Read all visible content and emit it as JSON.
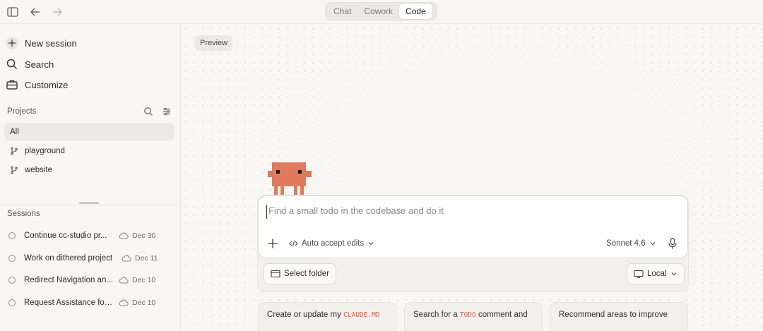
{
  "topbar": {
    "tabs": [
      {
        "label": "Chat",
        "active": false
      },
      {
        "label": "Cowork",
        "active": false
      },
      {
        "label": "Code",
        "active": true
      }
    ]
  },
  "sidebar": {
    "actions": [
      {
        "label": "New session",
        "icon": "plus-icon"
      },
      {
        "label": "Search",
        "icon": "search-icon"
      },
      {
        "label": "Customize",
        "icon": "briefcase-icon"
      }
    ],
    "projects_label": "Projects",
    "projects": [
      {
        "label": "All",
        "selected": true
      },
      {
        "label": "playground",
        "icon": "git-branch-icon"
      },
      {
        "label": "website",
        "icon": "git-branch-icon"
      }
    ],
    "sessions_label": "Sessions",
    "sessions": [
      {
        "title": "Continue cc-studio pr...",
        "date": "Dec 30"
      },
      {
        "title": "Work on dithered project",
        "date": "Dec 11"
      },
      {
        "title": "Redirect Navigation an...",
        "date": "Dec 10"
      },
      {
        "title": "Request Assistance for...",
        "date": "Dec 10"
      }
    ]
  },
  "main": {
    "preview_label": "Preview",
    "composer": {
      "placeholder": "Find a small todo in the codebase and do it",
      "mode_label": "Auto accept edits",
      "model_label": "Sonnet 4.6"
    },
    "select_folder_label": "Select folder",
    "environment_label": "Local",
    "suggestions": [
      {
        "prefix": "Create or update my",
        "code": "CLAUDE.MD",
        "suffix": ""
      },
      {
        "prefix": "Search for a",
        "code": "TODO",
        "suffix": "comment and"
      },
      {
        "prefix": "Recommend areas to improve",
        "code": "",
        "suffix": ""
      }
    ]
  },
  "colors": {
    "background": "#f8f7f3",
    "mascot": "#e07a5f",
    "code_token": "#d8604a"
  }
}
